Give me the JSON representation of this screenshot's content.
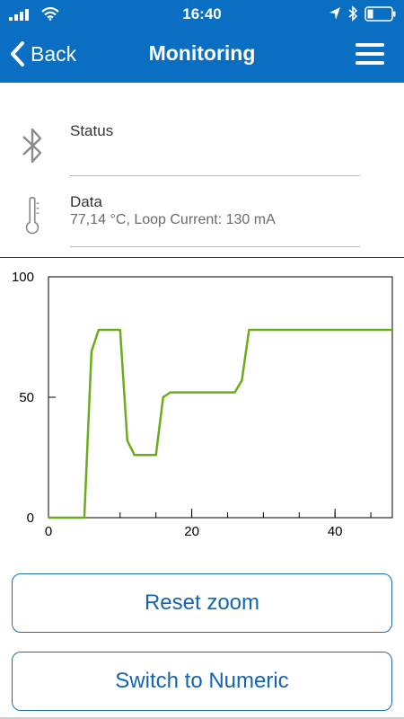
{
  "status_bar": {
    "time": "16:40"
  },
  "nav": {
    "back_label": "Back",
    "title": "Monitoring"
  },
  "rows": [
    {
      "title": "Status",
      "value": "",
      "icon": "bluetooth-icon"
    },
    {
      "title": "Data",
      "value": "77,14 °C, Loop Current: 130 mA",
      "icon": "thermometer-icon"
    }
  ],
  "colors": {
    "header": "#0a6fc2",
    "line": "#6aac1a",
    "button_text": "#1464b4"
  },
  "chart_data": {
    "type": "line",
    "title": "",
    "xlabel": "",
    "ylabel": "",
    "xlim": [
      0,
      48
    ],
    "ylim": [
      0,
      100
    ],
    "x_ticks": [
      0,
      20,
      40
    ],
    "y_ticks": [
      0,
      50,
      100
    ],
    "grid": false,
    "series": [
      {
        "x": [
          0,
          5,
          6,
          7,
          10,
          11,
          12,
          15,
          16,
          17,
          20,
          24,
          26,
          27,
          28,
          30,
          40,
          48
        ],
        "values": [
          0,
          0,
          69,
          78,
          78,
          32,
          26,
          26,
          50,
          52,
          52,
          52,
          52,
          57,
          78,
          78,
          78,
          78
        ]
      }
    ]
  },
  "buttons": {
    "reset_zoom": "Reset zoom",
    "switch_numeric": "Switch to Numeric"
  }
}
